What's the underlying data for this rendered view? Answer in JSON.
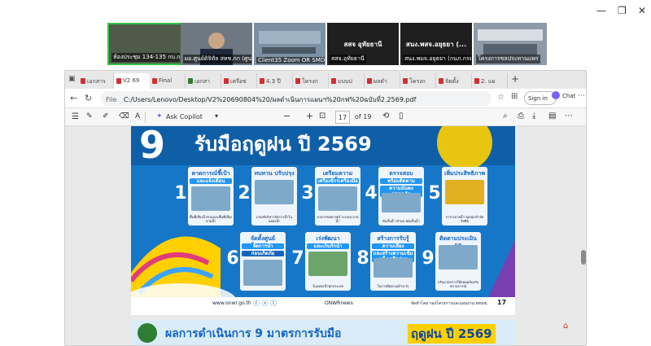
{
  "window_controls": {
    "minimize": "—",
    "restore": "❐",
    "close": "✕"
  },
  "meeting": {
    "participants": [
      {
        "name": "ห้องประชุม 134-135 กบ.กรม",
        "video": true
      },
      {
        "name": "ผอ.ศูนย์ดิจิทัล สทช.กก (ศูนย์กลาง)",
        "video": true
      },
      {
        "name": "Client35 Zoom OR SMDAC",
        "video": true
      },
      {
        "name": "สสจ.อุทัยธานี",
        "display_name": "สสจ อุทัยธานี",
        "video": false
      },
      {
        "name": "สนง.พมจ.อยุธยา (กนภ.กรมฯ)",
        "display_name": "สนง.พสจ.อยุธยา (...",
        "video": false
      },
      {
        "name": "โครงการชลประทานแพร่",
        "video": true
      }
    ]
  },
  "browser": {
    "tabs": [
      {
        "label": "เอกสาร"
      },
      {
        "label": "V2 69"
      },
      {
        "label": "Final"
      },
      {
        "label": "เอกสา"
      },
      {
        "label": "เครือข่"
      },
      {
        "label": "4.3 ปี"
      },
      {
        "label": "โครงก"
      },
      {
        "label": "แบบป"
      },
      {
        "label": "ผลดำ"
      },
      {
        "label": "โครงก"
      },
      {
        "label": "จัดตั้ง"
      },
      {
        "label": "2. แผ"
      }
    ],
    "active_tab": 1,
    "new_tab": "+",
    "file_label": "File",
    "url": "C:/Users/Lenovo/Desktop/V2%20690804%20/ผลดำเนินการแผนฯ%20กฟ%20ฉบับที่2.2569.pdf",
    "sign_in": "Sign in",
    "chat": "Chat",
    "more": "⋯"
  },
  "pdf_toolbar": {
    "ask_copilot": "Ask Copilot",
    "zoom_minus": "−",
    "zoom_plus": "+",
    "page_current": "17",
    "page_total": "of 19"
  },
  "page": {
    "big_number": "9",
    "title": "รับมือฤดูฝน ปี 2569",
    "footer_number": "17",
    "footer_credit": "จัดทำโดย กองโครงการและแผนงาน สทนช.",
    "footer_handle": "ONWRnews",
    "footer_web": "www.onwr.go.th",
    "measures": [
      {
        "n": "1",
        "title": "คาดการณ์ชี้เป้า",
        "sub": "และแจ้งเตือน",
        "desc": "พื้นที่เสี่ยงน้ำท่วมและพื้นที่เสี่ยงขาดน้ำ"
      },
      {
        "n": "2",
        "title": "ทบทวน ปรับปรุง",
        "sub": "",
        "desc": "เกณฑ์บริหารจัดการน้ำในแหล่งน้ำ"
      },
      {
        "n": "3",
        "title": "เตรียมความพร้อม",
        "sub": "เครื่องจักรเครื่องมือ",
        "desc": "อาคารชลศาสตร์ ระบบระบายน้ำ"
      },
      {
        "n": "4",
        "title": "ตรวจสอบ",
        "sub": "พร้อมติดตาม",
        "sub2": "ความมั่นคง ปลอดภัย",
        "desc": "คันกั้นน้ำ ทำนบ พนังกั้นน้ำ"
      },
      {
        "n": "5",
        "title": "เพิ่มประสิทธิภาพ",
        "sub": "",
        "desc": "การระบายน้ำ ขุดลอกกำจัดวัชพืช"
      },
      {
        "n": "6",
        "title": "จัดตั้งศูนย์บัญชาการ",
        "sub": "จัดการน้ำ",
        "sub2": "ก่อนเกิดภัย",
        "desc": ""
      },
      {
        "n": "7",
        "title": "เร่งพัฒนา",
        "sub": "และเก็บกักน้ำ",
        "desc": "ในแหล่งน้ำทุกประเภท"
      },
      {
        "n": "8",
        "title": "สร้างการรับรู้",
        "sub": "ความเสี่ยง",
        "sub2": "และสร้างความเข้มแข็งเครือข่าย",
        "desc": "ในการติดตามเฝ้าระวัง"
      },
      {
        "n": "9",
        "title": "ติดตามประเมินผล",
        "sub": "",
        "desc": "ปรับมาตรการให้สอดคล้องกับสถานการณ์"
      }
    ]
  },
  "page2": {
    "title_prefix": "ผลการดำเนินการ 9 มาตรการรับมือ",
    "title_highlight": "ฤดูฝน ปี 2569"
  },
  "colors": {
    "page_blue": "#1677c8",
    "accent_yellow": "#ffd000",
    "card_blue": "#2196f3"
  }
}
